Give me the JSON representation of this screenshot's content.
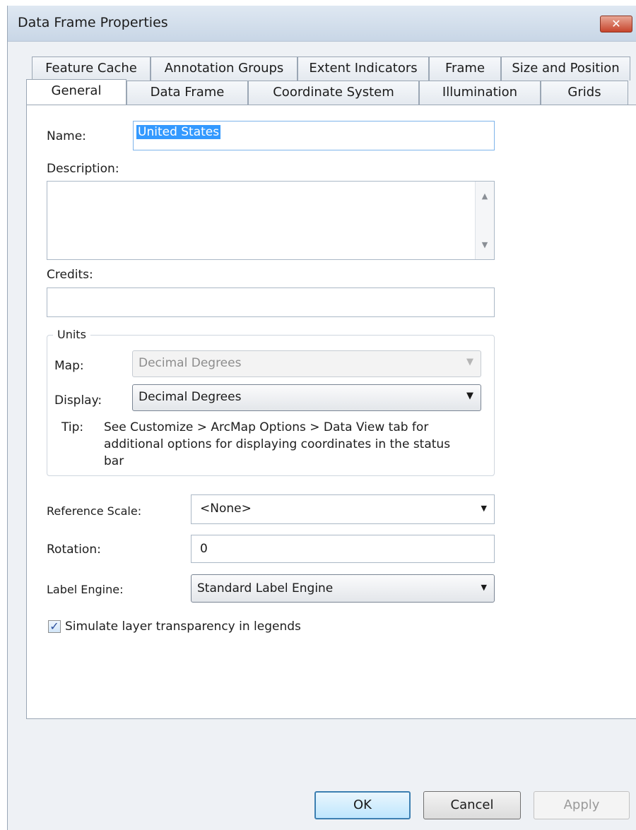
{
  "window": {
    "title": "Data Frame Properties",
    "close_label": "✕"
  },
  "tabs_back": [
    {
      "label": "Feature Cache"
    },
    {
      "label": "Annotation Groups"
    },
    {
      "label": "Extent Indicators"
    },
    {
      "label": "Frame"
    },
    {
      "label": "Size and Position"
    }
  ],
  "tabs_front": [
    {
      "label": "General",
      "active": true
    },
    {
      "label": "Data Frame"
    },
    {
      "label": "Coordinate System"
    },
    {
      "label": "Illumination"
    },
    {
      "label": "Grids"
    }
  ],
  "general": {
    "name_label": "Name:",
    "name_value": "United States",
    "description_label": "Description:",
    "description_value": "",
    "credits_label": "Credits:",
    "credits_value": "",
    "units": {
      "title": "Units",
      "map_label": "Map:",
      "map_value": "Decimal Degrees",
      "display_label": "Display:",
      "display_value": "Decimal Degrees",
      "tip_label": "Tip:",
      "tip_line1": "See Customize > ArcMap Options > Data View tab for",
      "tip_line2": "additional options for displaying coordinates in the status",
      "tip_line3": "bar"
    },
    "reference_scale_label": "Reference Scale:",
    "reference_scale_value": "<None>",
    "rotation_label": "Rotation:",
    "rotation_value": "0",
    "label_engine_label": "Label Engine:",
    "label_engine_value": "Standard Label Engine",
    "simulate_transparency_label": "Simulate layer transparency in legends",
    "simulate_transparency_checked": true
  },
  "buttons": {
    "ok": "OK",
    "cancel": "Cancel",
    "apply": "Apply"
  },
  "icons": {
    "checkmark": "✓",
    "dropdown": "▼",
    "scroll_up": "▲",
    "scroll_down": "▼"
  }
}
